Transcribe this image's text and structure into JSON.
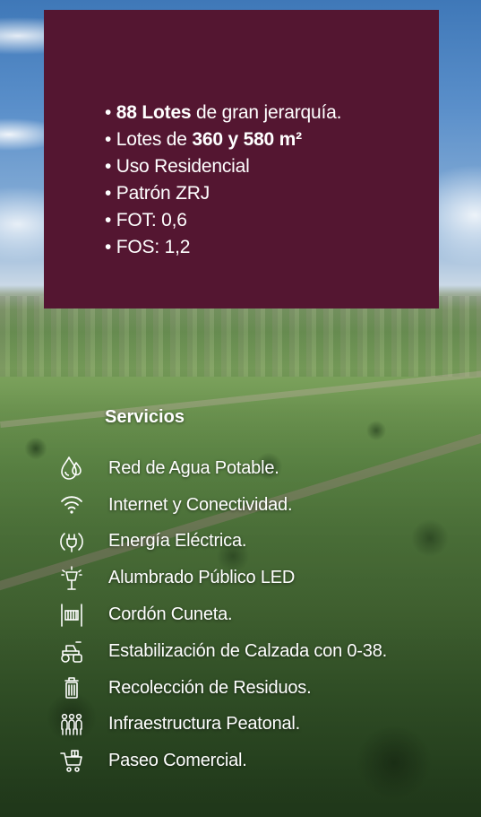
{
  "features": [
    {
      "bold": "88 Lotes",
      "text": " de gran jerarquía."
    },
    {
      "pre": "Lotes de ",
      "bold": "360 y 580 m²"
    },
    {
      "text": "Uso Residencial"
    },
    {
      "text": "Patrón ZRJ"
    },
    {
      "text": "FOT: 0,6"
    },
    {
      "text": "FOS: 1,2"
    }
  ],
  "bullet": "•",
  "services": {
    "title": "Servicios",
    "items": [
      {
        "icon": "water-drop-icon",
        "label": "Red de Agua Potable."
      },
      {
        "icon": "wifi-icon",
        "label": "Internet y Conectividad."
      },
      {
        "icon": "electric-plug-icon",
        "label": "Energía Eléctrica."
      },
      {
        "icon": "street-lamp-icon",
        "label": "Alumbrado Público LED"
      },
      {
        "icon": "curb-icon",
        "label": "Cordón Cuneta."
      },
      {
        "icon": "road-roller-icon",
        "label": "Estabilización de Calzada con 0-38."
      },
      {
        "icon": "trash-bin-icon",
        "label": "Recolección de Residuos."
      },
      {
        "icon": "pedestrians-icon",
        "label": "Infraestructura Peatonal."
      },
      {
        "icon": "shopping-cart-icon",
        "label": "Paseo Comercial."
      }
    ]
  },
  "colors": {
    "panel": "#541631",
    "text": "#ffffff"
  }
}
